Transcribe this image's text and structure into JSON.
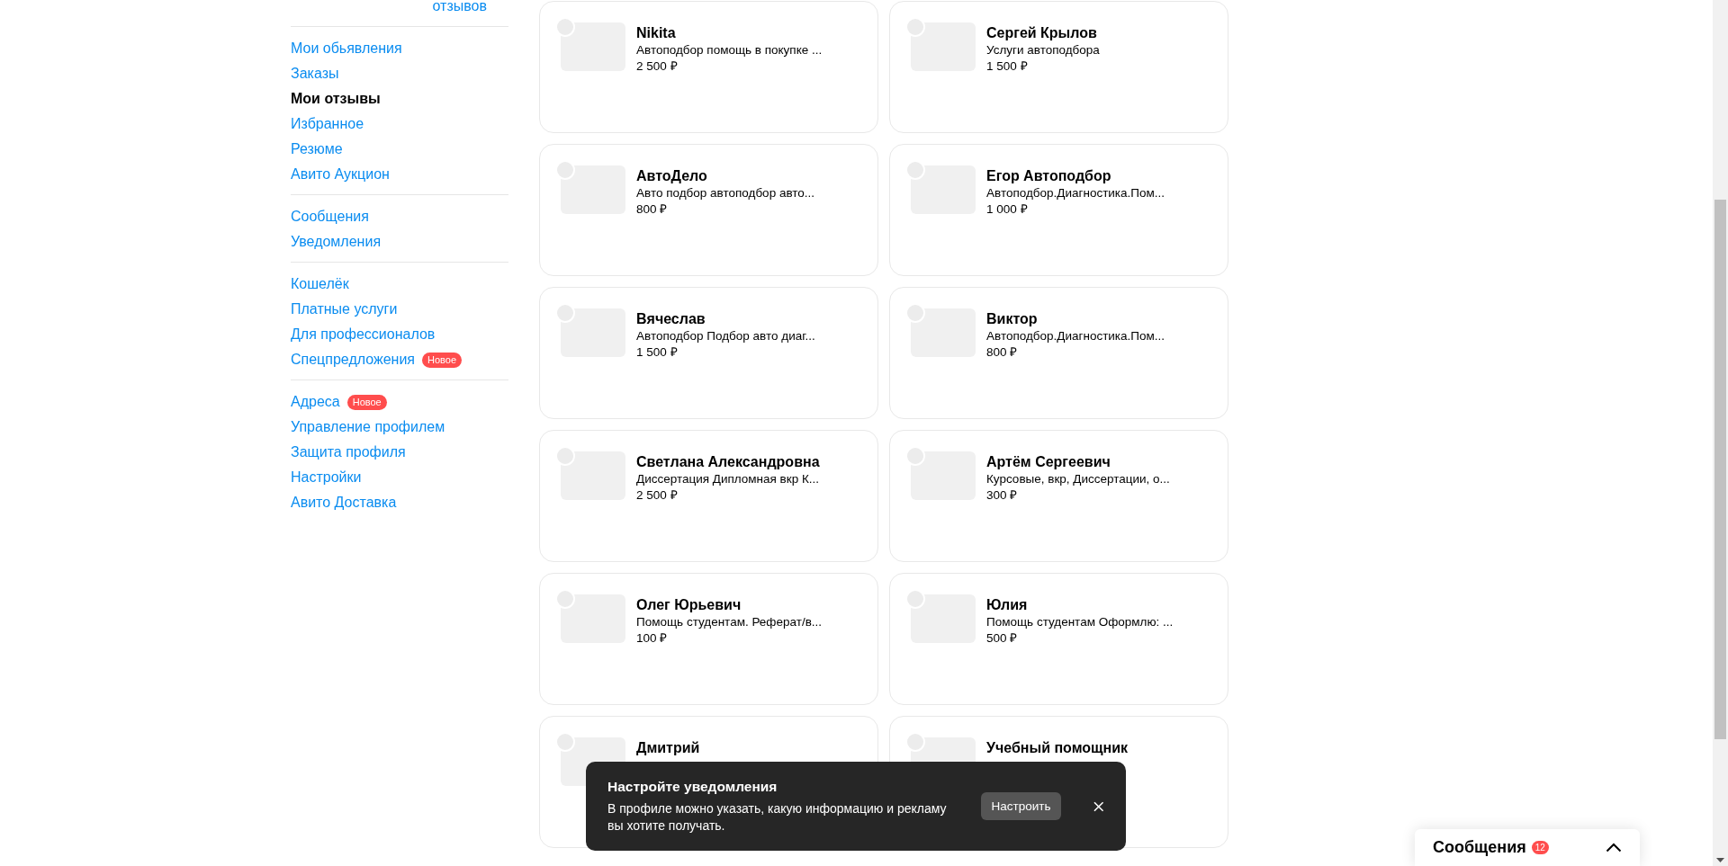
{
  "sidebar": {
    "reviews_link": "отзывов",
    "groups": [
      [
        {
          "label": "Мои обьявления",
          "selected": false
        },
        {
          "label": "Заказы",
          "selected": false
        },
        {
          "label": "Мои отзывы",
          "selected": true
        },
        {
          "label": "Избранное",
          "selected": false
        },
        {
          "label": "Резюме",
          "selected": false
        },
        {
          "label": "Авито Аукцион",
          "selected": false
        }
      ],
      [
        {
          "label": "Сообщения",
          "selected": false
        },
        {
          "label": "Уведомления",
          "selected": false
        }
      ],
      [
        {
          "label": "Кошелёк",
          "selected": false
        },
        {
          "label": "Платные услуги",
          "selected": false
        },
        {
          "label": "Для профессионалов",
          "selected": false
        },
        {
          "label": "Спецпредложения",
          "selected": false,
          "badge": "Новое"
        }
      ],
      [
        {
          "label": "Адреса",
          "selected": false,
          "badge": "Новое"
        },
        {
          "label": "Управление профилем",
          "selected": false
        },
        {
          "label": "Защита профиля",
          "selected": false
        },
        {
          "label": "Настройки",
          "selected": false
        },
        {
          "label": "Авито Доставка",
          "selected": false
        }
      ]
    ]
  },
  "cards": [
    {
      "name": "Nikita",
      "description": "Автоподбор помощь в покупке ...",
      "price": "2 500 ₽"
    },
    {
      "name": "Сергей Крылов",
      "description": "Услуги автоподбора",
      "price": "1 500 ₽"
    },
    {
      "name": "АвтоДело",
      "description": "Авто подбор автоподбор авто...",
      "price": "800 ₽"
    },
    {
      "name": "Егор Автоподбор",
      "description": "Автоподбор.Диагностика.Пом...",
      "price": "1 000 ₽"
    },
    {
      "name": "Вячеслав",
      "description": "Автоподбор Подбор авто диаг...",
      "price": "1 500 ₽"
    },
    {
      "name": "Виктор",
      "description": "Автоподбор.Диагностика.Пом...",
      "price": "800 ₽"
    },
    {
      "name": "Светлана Александровна",
      "description": "Диссертация Дипломная вкр К...",
      "price": "2 500 ₽"
    },
    {
      "name": "Артём Сергеевич",
      "description": "Курсовые, вкр, Диссертации, о...",
      "price": "300 ₽"
    },
    {
      "name": "Олег Юрьевич",
      "description": "Помощь студентам. Реферат/в...",
      "price": "100 ₽"
    },
    {
      "name": "Юлия",
      "description": "Помощь студентам Оформлю: ...",
      "price": "500 ₽"
    },
    {
      "name": "Дмитрий"
    },
    {
      "name": "Учебный помощник"
    }
  ],
  "toast": {
    "title": "Настройте уведомления",
    "text": "В профиле можно указать, какую информацию и рекламу вы хотите получать.",
    "button": "Настроить"
  },
  "messages_widget": {
    "title": "Сообщения",
    "count": "12"
  }
}
